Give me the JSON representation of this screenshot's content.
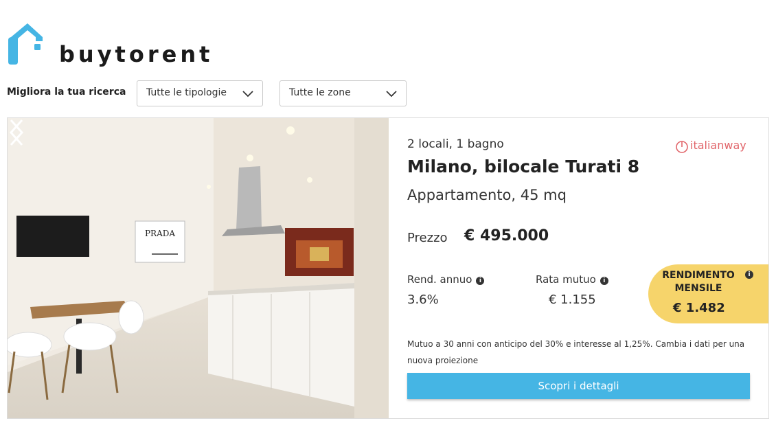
{
  "brand": {
    "name": "buytorent",
    "logo_icon": "house-key-icon",
    "logo_color": "#45b5e4"
  },
  "filters": {
    "label": "Migliora la tua ricerca",
    "type_select": {
      "value": "Tutte le tipologie",
      "icon": "chevron-down-icon"
    },
    "zone_select": {
      "value": "Tutte le zone",
      "icon": "chevron-down-icon"
    }
  },
  "listing": {
    "photo": {
      "description_icon": "listing-photo",
      "prev_icon": "chevron-left-icon",
      "next_icon": "chevron-right-icon"
    },
    "rooms": "2 locali, 1 bagno",
    "agency": {
      "name": "italianway",
      "icon": "italianway-logo-icon",
      "color": "#e1666b"
    },
    "title": "Milano, bilocale Turati 8",
    "subtitle": "Appartamento, 45 mq",
    "price_label": "Prezzo",
    "price_value": "€ 495.000",
    "metrics": {
      "annual_yield_label": "Rend. annuo",
      "annual_yield_value": "3.6%",
      "mortgage_rate_label": "Rata mutuo",
      "mortgage_rate_value": "€ 1.155",
      "info_icon": "info-icon"
    },
    "monthly_yield": {
      "title": "RENDIMENTO MENSILE",
      "value": "€ 1.482",
      "color": "#f6d46b"
    },
    "mortgage_note": "Mutuo a 30 anni con anticipo del 30% e interesse al 1,25%. Cambia i dati per una nuova proiezione",
    "cta_label": "Scopri i dettagli",
    "cta_color": "#45b5e4"
  }
}
